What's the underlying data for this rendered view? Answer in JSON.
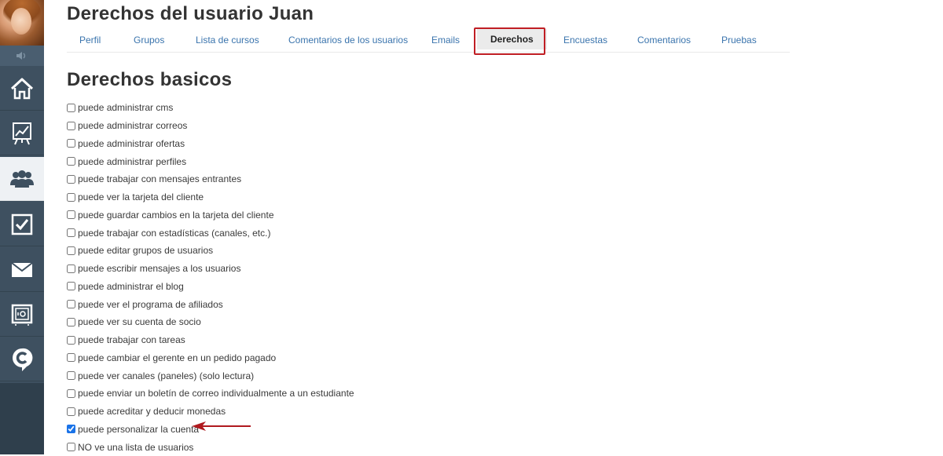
{
  "page": {
    "title": "Derechos del usuario Juan",
    "section_title": "Derechos basicos"
  },
  "sidebar": {
    "items": [
      {
        "name": "home",
        "icon": "home-icon",
        "active": false
      },
      {
        "name": "analytics",
        "icon": "chart-board-icon",
        "active": false
      },
      {
        "name": "users",
        "icon": "users-group-icon",
        "active": true
      },
      {
        "name": "tasks",
        "icon": "checkbox-icon",
        "active": false
      },
      {
        "name": "mail",
        "icon": "envelope-icon",
        "active": false
      },
      {
        "name": "safe",
        "icon": "safe-icon",
        "active": false
      },
      {
        "name": "chat",
        "icon": "chat-c-icon",
        "active": false
      }
    ],
    "sound_icon": "speaker-icon"
  },
  "tabs": [
    {
      "label": "Perfil"
    },
    {
      "label": "Grupos"
    },
    {
      "label": "Lista de cursos"
    },
    {
      "label": "Comentarios de los usuarios"
    },
    {
      "label": "Emails"
    },
    {
      "label": "Derechos",
      "active": true
    },
    {
      "label": "Encuestas"
    },
    {
      "label": "Comentarios"
    },
    {
      "label": "Pruebas"
    }
  ],
  "permissions": [
    {
      "label": "puede administrar cms",
      "checked": false
    },
    {
      "label": "puede administrar correos",
      "checked": false
    },
    {
      "label": "puede administrar ofertas",
      "checked": false
    },
    {
      "label": "puede administrar perfiles",
      "checked": false
    },
    {
      "label": "puede trabajar con mensajes entrantes",
      "checked": false
    },
    {
      "label": "puede ver la tarjeta del cliente",
      "checked": false
    },
    {
      "label": "puede guardar cambios en la tarjeta del cliente",
      "checked": false
    },
    {
      "label": "puede trabajar con estadísticas (canales, etc.)",
      "checked": false
    },
    {
      "label": "puede editar grupos de usuarios",
      "checked": false
    },
    {
      "label": "puede escribir mensajes a los usuarios",
      "checked": false
    },
    {
      "label": "puede administrar el blog",
      "checked": false
    },
    {
      "label": "puede ver el programa de afiliados",
      "checked": false
    },
    {
      "label": "puede ver su cuenta de socio",
      "checked": false
    },
    {
      "label": "puede trabajar con tareas",
      "checked": false
    },
    {
      "label": "puede cambiar el gerente en un pedido pagado",
      "checked": false
    },
    {
      "label": "puede ver canales (paneles) (solo lectura)",
      "checked": false
    },
    {
      "label": "puede enviar un boletín de correo individualmente a un estudiante",
      "checked": false
    },
    {
      "label": "puede acreditar y deducir monedas",
      "checked": false
    },
    {
      "label": "puede personalizar la cuenta",
      "checked": true
    },
    {
      "label": "NO ve una lista de usuarios",
      "checked": false
    }
  ],
  "colors": {
    "sidebar": "#3e5060",
    "tab_link": "#3a74ad",
    "highlight": "#c01e24"
  }
}
